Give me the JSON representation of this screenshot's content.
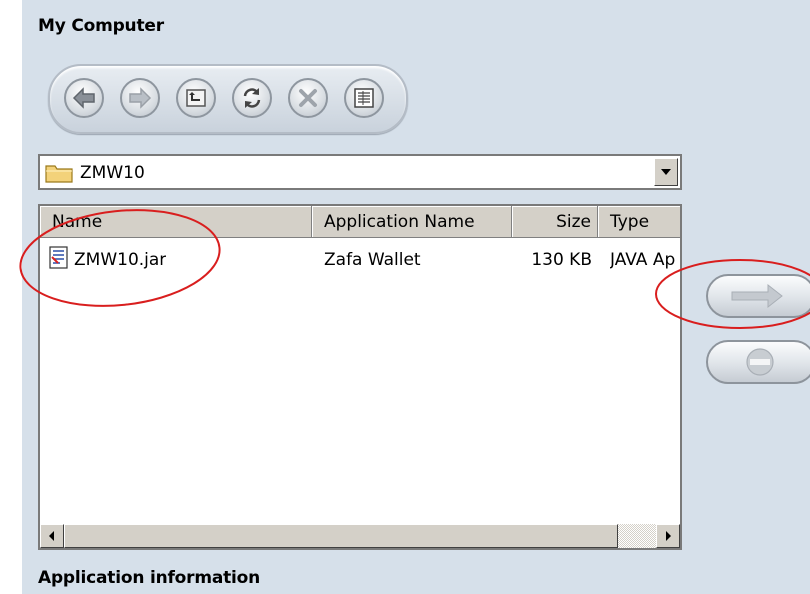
{
  "section_title": "My Computer",
  "toolbar": {
    "buttons": [
      {
        "icon": "back-arrow-icon",
        "label": "Back"
      },
      {
        "icon": "forward-arrow-icon",
        "label": "Forward"
      },
      {
        "icon": "up-folder-icon",
        "label": "Up"
      },
      {
        "icon": "refresh-icon",
        "label": "Refresh"
      },
      {
        "icon": "delete-icon",
        "label": "Delete"
      },
      {
        "icon": "details-view-icon",
        "label": "View"
      }
    ]
  },
  "path_combo": {
    "icon": "folder-icon",
    "value": "ZMW10"
  },
  "file_list": {
    "columns": [
      "Name",
      "Application Name",
      "Size",
      "Type"
    ],
    "rows": [
      {
        "icon": "jar-file-icon",
        "name": "ZMW10.jar",
        "app_name": "Zafa Wallet",
        "size": "130 KB",
        "type": "JAVA Ap"
      }
    ]
  },
  "side_buttons": [
    {
      "icon": "right-arrow-icon",
      "label": "Install"
    },
    {
      "icon": "remove-icon",
      "label": "Remove"
    }
  ],
  "footer_title": "Application information",
  "colors": {
    "panel": "#d6e0ea",
    "annotation": "#d91e1e",
    "chrome": "#d4d0c8"
  }
}
